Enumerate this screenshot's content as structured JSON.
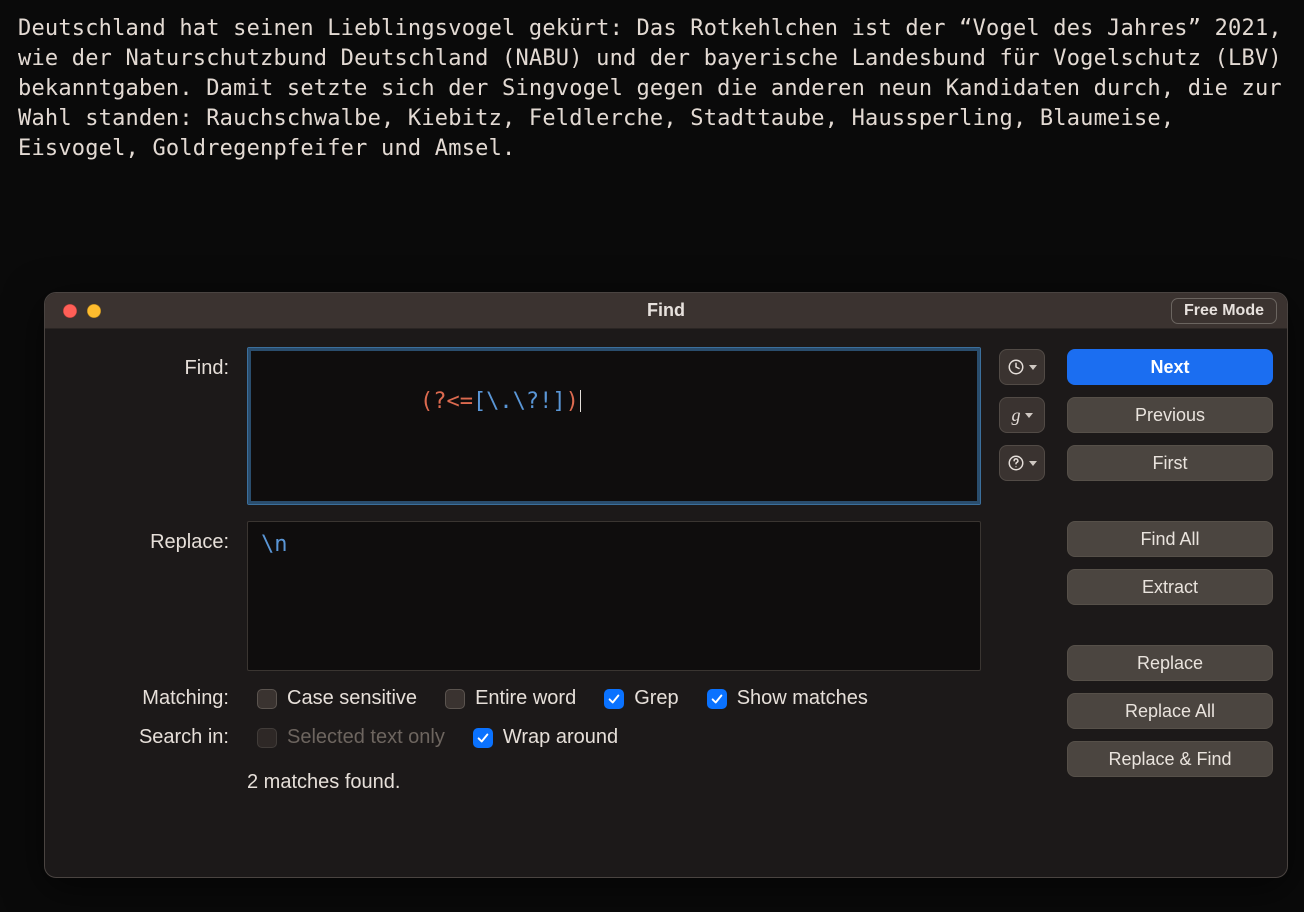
{
  "editor_text": "Deutschland hat seinen Lieblingsvogel gekürt: Das Rotkehlchen ist der “Vogel des Jahres” 2021, wie der Naturschutzbund Deutschland (NABU) und der bayerische Landesbund für Vogelschutz (LBV) bekanntgaben. Damit setzte sich der Singvogel gegen die anderen neun Kandidaten durch, die zur Wahl standen: Rauchschwalbe, Kiebitz, Feldlerche, Stadttaube, Haussperling, Blaumeise, Eisvogel, Goldregenpfeifer und Amsel.",
  "dialog": {
    "title": "Find",
    "mode_label": "Free Mode",
    "find_label": "Find:",
    "replace_label": "Replace:",
    "find_value": "(?<=[\\.\\?!])",
    "find_tokens": {
      "meta_open": "(?<=",
      "body": "[\\.\\?!]",
      "meta_close": ")"
    },
    "replace_value": "\\n",
    "tool": {
      "history": "history",
      "grep": "g",
      "help": "?"
    },
    "matching_label": "Matching:",
    "searchin_label": "Search in:",
    "options": {
      "case_sensitive": {
        "label": "Case sensitive",
        "checked": false,
        "disabled": false
      },
      "entire_word": {
        "label": "Entire word",
        "checked": false,
        "disabled": false
      },
      "grep": {
        "label": "Grep",
        "checked": true,
        "disabled": false
      },
      "show_matches": {
        "label": "Show matches",
        "checked": true,
        "disabled": false
      },
      "selected_text": {
        "label": "Selected text only",
        "checked": false,
        "disabled": true
      },
      "wrap_around": {
        "label": "Wrap around",
        "checked": true,
        "disabled": false
      }
    },
    "status": "2 matches found.",
    "buttons": {
      "next": "Next",
      "previous": "Previous",
      "first": "First",
      "find_all": "Find All",
      "extract": "Extract",
      "replace": "Replace",
      "replace_all": "Replace All",
      "replace_find": "Replace & Find"
    }
  }
}
